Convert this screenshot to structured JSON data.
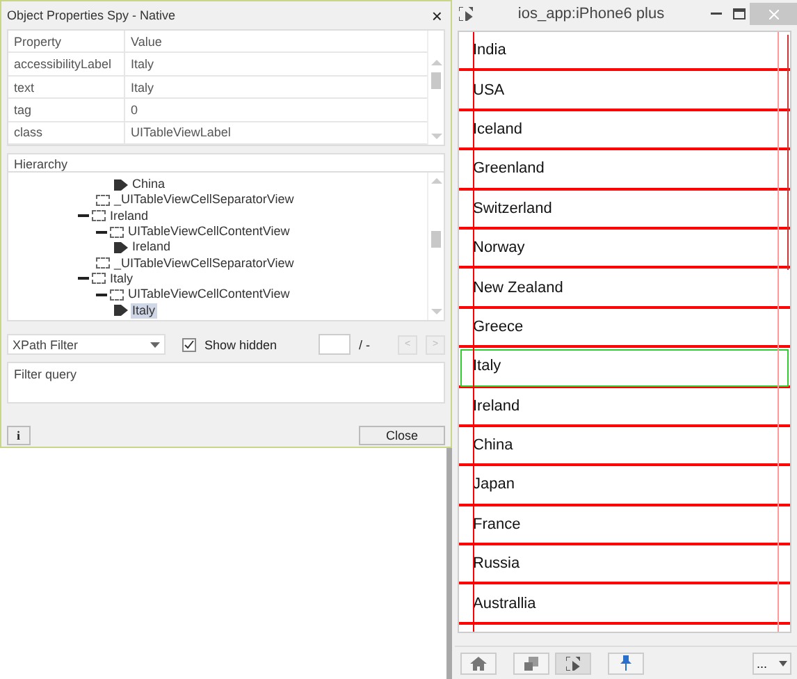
{
  "spy": {
    "title": "Object Properties Spy - Native",
    "close": "×",
    "properties": {
      "columns": [
        "Property",
        "Value"
      ],
      "rows": [
        {
          "property": "accessibilityLabel",
          "value": "Italy"
        },
        {
          "property": "text",
          "value": "Italy"
        },
        {
          "property": "tag",
          "value": "0"
        },
        {
          "property": "class",
          "value": "UITableViewLabel"
        }
      ]
    },
    "hierarchy": {
      "header": "Hierarchy",
      "tree": [
        {
          "children": [
            {
              "children": [
                {
                  "kind": "tag",
                  "label": "China",
                  "selected": false
                }
              ]
            },
            {
              "kind": "view",
              "label": "_UITableViewCellSeparatorView"
            }
          ]
        },
        {
          "kind": "view",
          "label": "Ireland",
          "children": [
            {
              "kind": "view",
              "label": "UITableViewCellContentView",
              "children": [
                {
                  "kind": "tag",
                  "label": "Ireland",
                  "selected": false
                }
              ]
            },
            {
              "kind": "view",
              "label": "_UITableViewCellSeparatorView"
            }
          ]
        },
        {
          "kind": "view",
          "label": "Italy",
          "children": [
            {
              "kind": "view",
              "label": "UITableViewCellContentView",
              "children": [
                {
                  "kind": "tag",
                  "label": "Italy",
                  "selected": true
                }
              ]
            }
          ]
        }
      ]
    },
    "filter": {
      "mode": "XPath Filter",
      "show_hidden": {
        "label": "Show hidden",
        "checked": true
      },
      "count": "/ -",
      "prev": "<",
      "next": ">",
      "placeholder": "Filter query"
    },
    "info": "i",
    "close_button": "Close"
  },
  "device": {
    "title": "ios_app:iPhone6 plus",
    "rows": [
      {
        "label": "India",
        "selected": false
      },
      {
        "label": "USA",
        "selected": false
      },
      {
        "label": "Iceland",
        "selected": false
      },
      {
        "label": "Greenland",
        "selected": false
      },
      {
        "label": "Switzerland",
        "selected": false
      },
      {
        "label": "Norway",
        "selected": false
      },
      {
        "label": "New Zealand",
        "selected": false
      },
      {
        "label": "Greece",
        "selected": false
      },
      {
        "label": "Italy",
        "selected": true
      },
      {
        "label": "Ireland",
        "selected": false
      },
      {
        "label": "China",
        "selected": false
      },
      {
        "label": "Japan",
        "selected": false
      },
      {
        "label": "France",
        "selected": false
      },
      {
        "label": "Russia",
        "selected": false
      },
      {
        "label": "Australlia",
        "selected": false
      }
    ],
    "more": "..."
  }
}
